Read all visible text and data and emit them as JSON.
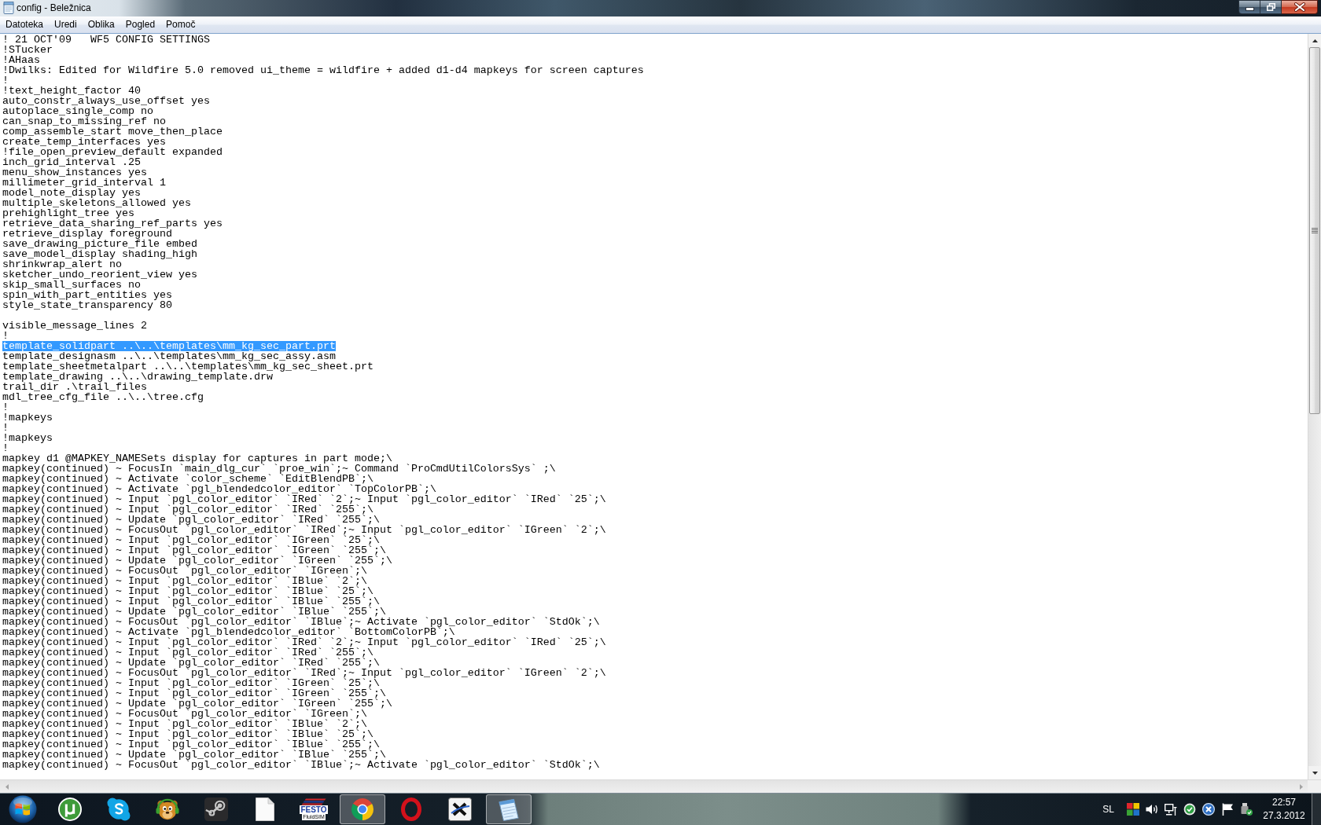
{
  "window": {
    "title": "config - Beležnica"
  },
  "menu": [
    "Datoteka",
    "Uredi",
    "Oblika",
    "Pogled",
    "Pomoč"
  ],
  "editor": {
    "sections": [
      [
        {
          "text": "! 21 OCT'09   WF5 CONFIG SETTINGS",
          "selected": false
        },
        {
          "text": "!STucker",
          "selected": false
        },
        {
          "text": "!AHaas",
          "selected": false
        },
        {
          "text": "!Dwilks: Edited for Wildfire 5.0 removed ui_theme = wildfire + added d1-d4 mapkeys for screen captures",
          "selected": false
        },
        {
          "text": "!",
          "selected": false
        },
        {
          "text": "!text_height_factor 40",
          "selected": false
        },
        {
          "text": "auto_constr_always_use_offset yes",
          "selected": false
        },
        {
          "text": "autoplace_single_comp no",
          "selected": false
        },
        {
          "text": "can_snap_to_missing_ref no",
          "selected": false
        },
        {
          "text": "comp_assemble_start move_then_place",
          "selected": false
        },
        {
          "text": "create_temp_interfaces yes",
          "selected": false
        },
        {
          "text": "!file_open_preview_default expanded",
          "selected": false
        },
        {
          "text": "inch_grid_interval .25",
          "selected": false
        },
        {
          "text": "menu_show_instances yes",
          "selected": false
        },
        {
          "text": "millimeter_grid_interval 1",
          "selected": false
        },
        {
          "text": "model_note_display yes",
          "selected": false
        },
        {
          "text": "multiple_skeletons_allowed yes",
          "selected": false
        },
        {
          "text": "prehighlight_tree yes",
          "selected": false
        },
        {
          "text": "retrieve_data_sharing_ref_parts yes",
          "selected": false
        },
        {
          "text": "retrieve_display foreground",
          "selected": false
        },
        {
          "text": "save_drawing_picture_file embed",
          "selected": false
        },
        {
          "text": "save_model_display shading_high",
          "selected": false
        },
        {
          "text": "shrinkwrap_alert no",
          "selected": false
        },
        {
          "text": "sketcher_undo_reorient_view yes",
          "selected": false
        },
        {
          "text": "skip_small_surfaces no",
          "selected": false
        },
        {
          "text": "spin_with_part_entities yes",
          "selected": false
        },
        {
          "text": "style_state_transparency 80",
          "selected": false
        }
      ],
      [
        {
          "text": "visible_message_lines 2",
          "selected": false
        },
        {
          "text": "!",
          "selected": false
        },
        {
          "text": "template_solidpart ..\\..\\templates\\mm_kg_sec_part.prt",
          "selected": true
        },
        {
          "text": "template_designasm ..\\..\\templates\\mm_kg_sec_assy.asm",
          "selected": false
        },
        {
          "text": "template_sheetmetalpart ..\\..\\templates\\mm_kg_sec_sheet.prt",
          "selected": false
        },
        {
          "text": "template_drawing ..\\..\\drawing_template.drw",
          "selected": false
        },
        {
          "text": "trail_dir .\\trail_files",
          "selected": false
        },
        {
          "text": "mdl_tree_cfg_file ..\\..\\tree.cfg",
          "selected": false
        },
        {
          "text": "!",
          "selected": false
        },
        {
          "text": "!mapkeys",
          "selected": false
        },
        {
          "text": "!",
          "selected": false
        },
        {
          "text": "!mapkeys",
          "selected": false
        },
        {
          "text": "!",
          "selected": false
        },
        {
          "text": "mapkey d1 @MAPKEY_NAMESets display for captures in part mode;\\",
          "selected": false
        },
        {
          "text": "mapkey(continued) ~ FocusIn `main_dlg_cur` `proe_win`;~ Command `ProCmdUtilColorsSys` ;\\",
          "selected": false
        },
        {
          "text": "mapkey(continued) ~ Activate `color_scheme` `EditBlendPB`;\\",
          "selected": false
        },
        {
          "text": "mapkey(continued) ~ Activate `pgl_blendedcolor_editor` `TopColorPB`;\\",
          "selected": false
        },
        {
          "text": "mapkey(continued) ~ Input `pgl_color_editor` `IRed` `2`;~ Input `pgl_color_editor` `IRed` `25`;\\",
          "selected": false
        },
        {
          "text": "mapkey(continued) ~ Input `pgl_color_editor` `IRed` `255`;\\",
          "selected": false
        },
        {
          "text": "mapkey(continued) ~ Update `pgl_color_editor` `IRed` `255`;\\",
          "selected": false
        },
        {
          "text": "mapkey(continued) ~ FocusOut `pgl_color_editor` `IRed`;~ Input `pgl_color_editor` `IGreen` `2`;\\",
          "selected": false
        },
        {
          "text": "mapkey(continued) ~ Input `pgl_color_editor` `IGreen` `25`;\\",
          "selected": false
        },
        {
          "text": "mapkey(continued) ~ Input `pgl_color_editor` `IGreen` `255`;\\",
          "selected": false
        },
        {
          "text": "mapkey(continued) ~ Update `pgl_color_editor` `IGreen` `255`;\\",
          "selected": false
        },
        {
          "text": "mapkey(continued) ~ FocusOut `pgl_color_editor` `IGreen`;\\",
          "selected": false
        },
        {
          "text": "mapkey(continued) ~ Input `pgl_color_editor` `IBlue` `2`;\\",
          "selected": false
        },
        {
          "text": "mapkey(continued) ~ Input `pgl_color_editor` `IBlue` `25`;\\",
          "selected": false
        },
        {
          "text": "mapkey(continued) ~ Input `pgl_color_editor` `IBlue` `255`;\\",
          "selected": false
        },
        {
          "text": "mapkey(continued) ~ Update `pgl_color_editor` `IBlue` `255`;\\",
          "selected": false
        },
        {
          "text": "mapkey(continued) ~ FocusOut `pgl_color_editor` `IBlue`;~ Activate `pgl_color_editor` `StdOk`;\\",
          "selected": false
        },
        {
          "text": "mapkey(continued) ~ Activate `pgl_blendedcolor_editor` `BottomColorPB`;\\",
          "selected": false
        },
        {
          "text": "mapkey(continued) ~ Input `pgl_color_editor` `IRed` `2`;~ Input `pgl_color_editor` `IRed` `25`;\\",
          "selected": false
        },
        {
          "text": "mapkey(continued) ~ Input `pgl_color_editor` `IRed` `255`;\\",
          "selected": false
        },
        {
          "text": "mapkey(continued) ~ Update `pgl_color_editor` `IRed` `255`;\\",
          "selected": false
        },
        {
          "text": "mapkey(continued) ~ FocusOut `pgl_color_editor` `IRed`;~ Input `pgl_color_editor` `IGreen` `2`;\\",
          "selected": false
        },
        {
          "text": "mapkey(continued) ~ Input `pgl_color_editor` `IGreen` `25`;\\",
          "selected": false
        },
        {
          "text": "mapkey(continued) ~ Input `pgl_color_editor` `IGreen` `255`;\\",
          "selected": false
        },
        {
          "text": "mapkey(continued) ~ Update `pgl_color_editor` `IGreen` `255`;\\",
          "selected": false
        },
        {
          "text": "mapkey(continued) ~ FocusOut `pgl_color_editor` `IGreen`;\\",
          "selected": false
        },
        {
          "text": "mapkey(continued) ~ Input `pgl_color_editor` `IBlue` `2`;\\",
          "selected": false
        },
        {
          "text": "mapkey(continued) ~ Input `pgl_color_editor` `IBlue` `25`;\\",
          "selected": false
        },
        {
          "text": "mapkey(continued) ~ Input `pgl_color_editor` `IBlue` `255`;\\",
          "selected": false
        },
        {
          "text": "mapkey(continued) ~ Update `pgl_color_editor` `IBlue` `255`;\\",
          "selected": false
        },
        {
          "text": "mapkey(continued) ~ FocusOut `pgl_color_editor` `IBlue`;~ Activate `pgl_color_editor` `StdOk`;\\",
          "selected": false
        }
      ]
    ]
  },
  "taskbar": {
    "apps": [
      {
        "running": false
      },
      {
        "running": false
      },
      {
        "running": false
      },
      {
        "running": false
      },
      {
        "running": false
      },
      {
        "running": false,
        "logo_text": [
          "FESTO",
          "FluidSIM"
        ]
      },
      {
        "running": true
      },
      {
        "running": false
      },
      {
        "running": false
      },
      {
        "running": true
      }
    ],
    "language": "SL",
    "clock": {
      "time": "22:57",
      "date": "27.3.2012"
    }
  }
}
